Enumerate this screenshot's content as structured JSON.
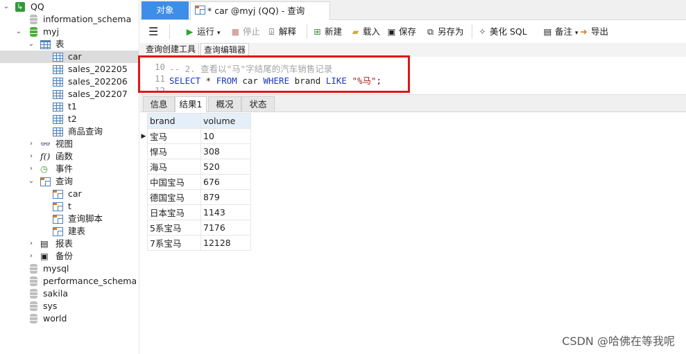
{
  "sidebar": {
    "connection": "QQ",
    "items": [
      {
        "label": "information_schema"
      },
      {
        "label": "myj"
      },
      {
        "label": "表"
      },
      {
        "label": "car"
      },
      {
        "label": "sales_202205"
      },
      {
        "label": "sales_202206"
      },
      {
        "label": "sales_202207"
      },
      {
        "label": "t1"
      },
      {
        "label": "t2"
      },
      {
        "label": "商品查询"
      },
      {
        "label": "视图"
      },
      {
        "label": "函数"
      },
      {
        "label": "事件"
      },
      {
        "label": "查询"
      },
      {
        "label": "car"
      },
      {
        "label": "t"
      },
      {
        "label": "查询脚本"
      },
      {
        "label": "建表"
      },
      {
        "label": "报表"
      },
      {
        "label": "备份"
      },
      {
        "label": "mysql"
      },
      {
        "label": "performance_schema"
      },
      {
        "label": "sakila"
      },
      {
        "label": "sys"
      },
      {
        "label": "world"
      }
    ]
  },
  "tabs": {
    "objects": "对象",
    "query": "* car @myj (QQ) - 查询"
  },
  "toolbar": {
    "run": "运行",
    "stop": "停止",
    "explain": "解释",
    "new": "新建",
    "load": "载入",
    "save": "保存",
    "save_as": "另存为",
    "beautify": "美化 SQL",
    "comment": "备注",
    "export": "导出"
  },
  "subtabs": {
    "builder": "查询创建工具",
    "editor": "查询编辑器"
  },
  "editor": {
    "lines": [
      {
        "num": "10",
        "comment": "-- 2. 查看以\"马\"字结尾的汽车销售记录"
      },
      {
        "num": "11",
        "kw1": "SELECT",
        "t1": " * ",
        "kw2": "FROM",
        "t2": " car ",
        "kw3": "WHERE",
        "t3": " brand ",
        "kw4": "LIKE",
        "t4": " ",
        "str": "\"%马\"",
        "t5": ";"
      },
      {
        "num": "12"
      }
    ]
  },
  "result_tabs": [
    "信息",
    "结果1",
    "概况",
    "状态"
  ],
  "grid": {
    "columns": [
      "brand",
      "volume"
    ],
    "rows": [
      [
        "宝马",
        "10"
      ],
      [
        "悍马",
        "308"
      ],
      [
        "海马",
        "520"
      ],
      [
        "中国宝马",
        "676"
      ],
      [
        "德国宝马",
        "879"
      ],
      [
        "日本宝马",
        "1143"
      ],
      [
        "5系宝马",
        "7176"
      ],
      [
        "7系宝马",
        "12128"
      ]
    ]
  },
  "watermark": "CSDN @哈佛在等我呢",
  "colors": {
    "accent_tab": "#3d8ee8",
    "highlight_box": "#e01515",
    "keyword": "#1a35c8",
    "string": "#b01a1a",
    "db_active": "#4caf3c"
  }
}
